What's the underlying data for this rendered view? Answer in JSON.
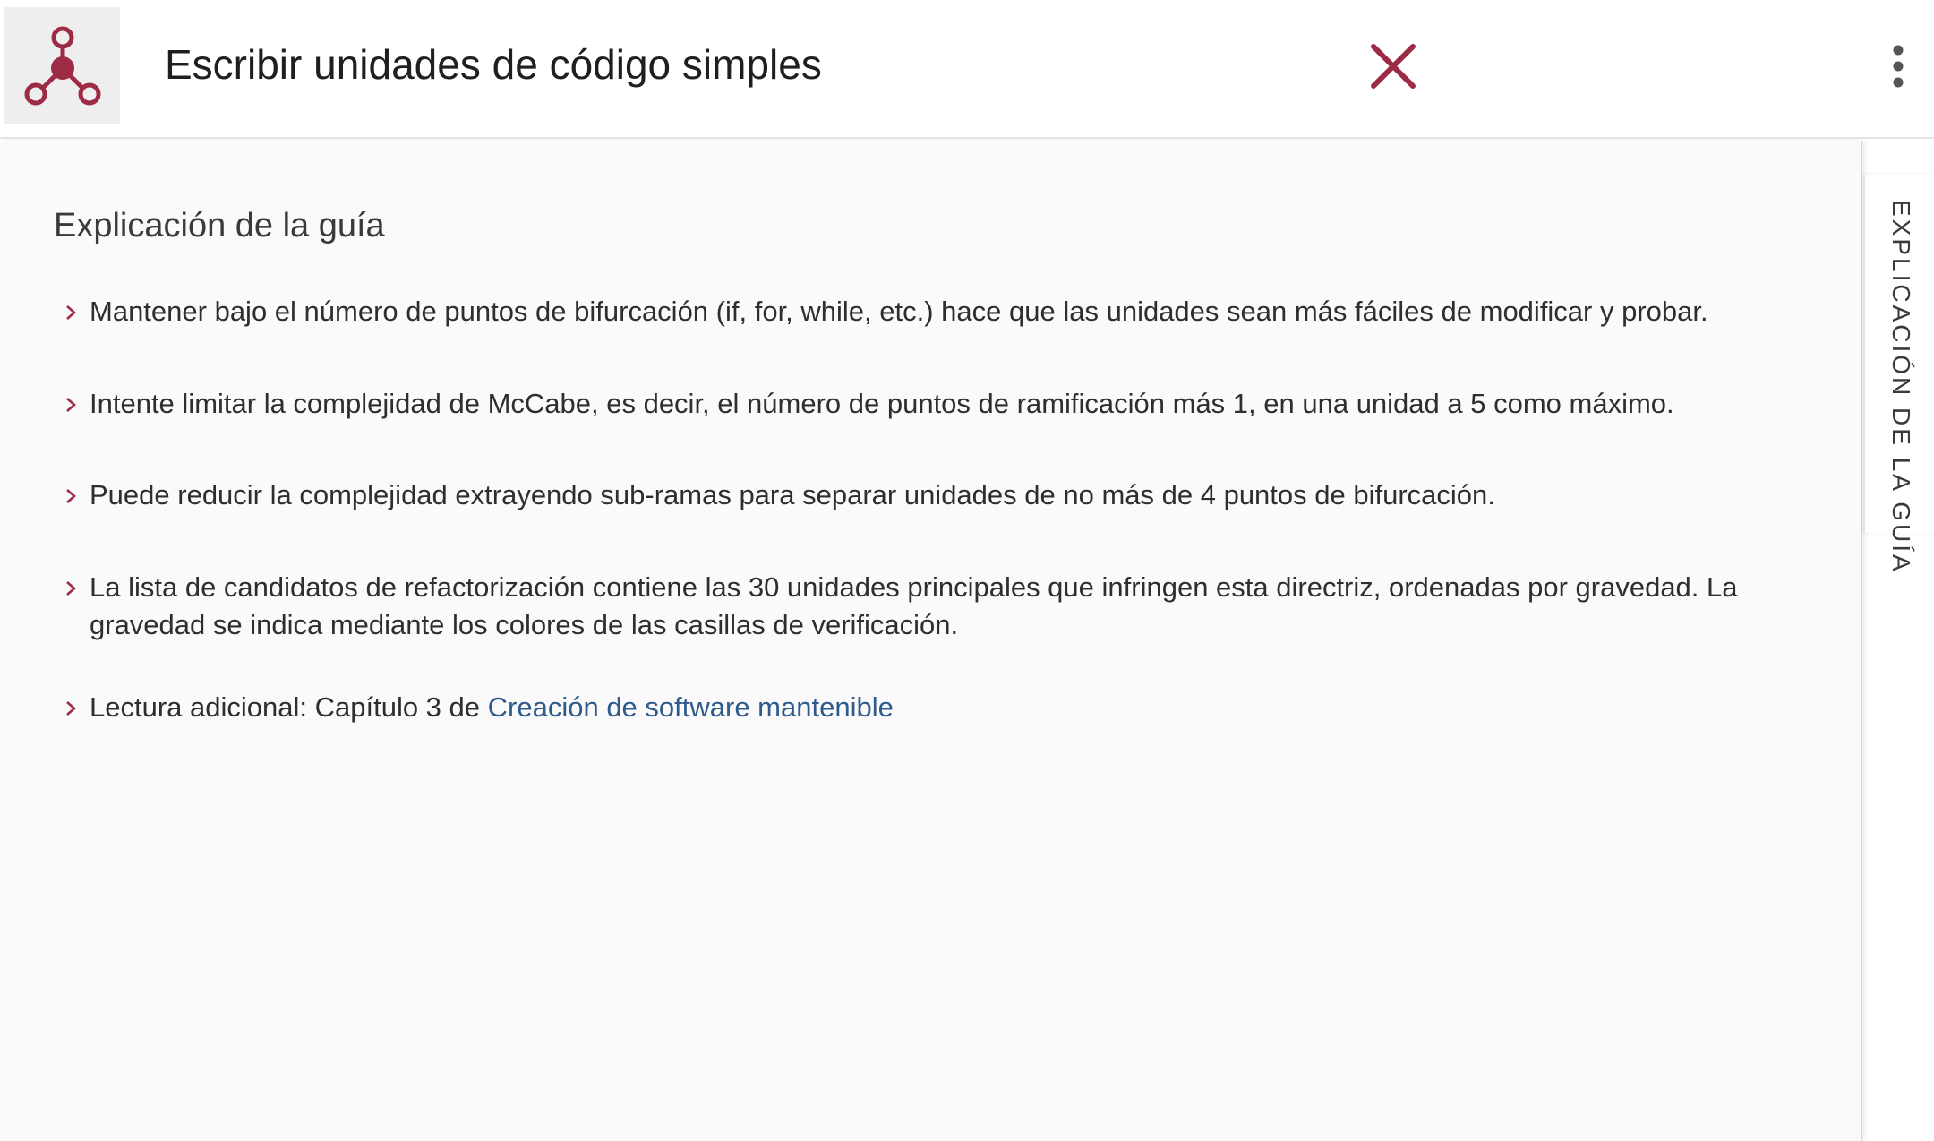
{
  "header": {
    "title": "Escribir unidades de código simples",
    "logo_icon": "molecule-nodes-icon",
    "close_icon": "close-icon",
    "menu_icon": "more-vertical-icon",
    "accent_color": "#9e2b45"
  },
  "panel": {
    "heading": "Explicación de la guía",
    "bullets": [
      "Mantener bajo el número de puntos de bifurcación (if, for, while, etc.) hace que las unidades sean más fáciles de modificar y probar.",
      "Intente limitar la complejidad de McCabe, es decir, el número de puntos de ramificación más 1, en una unidad a 5 como máximo.",
      "Puede reducir la complejidad extrayendo sub-ramas para separar unidades de no más de 4 puntos de bifurcación.",
      "La lista de candidatos de refactorización contiene las 30 unidades principales que infringen esta directriz, ordenadas por gravedad. La gravedad se indica mediante los colores de las casillas de verificación."
    ],
    "further_reading": {
      "prefix": "Lectura adicional: Capítulo 3 de ",
      "link_text": "Creación de software mantenible"
    },
    "bullet_icon": "chevron-right-icon"
  },
  "side_tab": {
    "label": "EXPLICACIÓN DE LA GUÍA"
  }
}
